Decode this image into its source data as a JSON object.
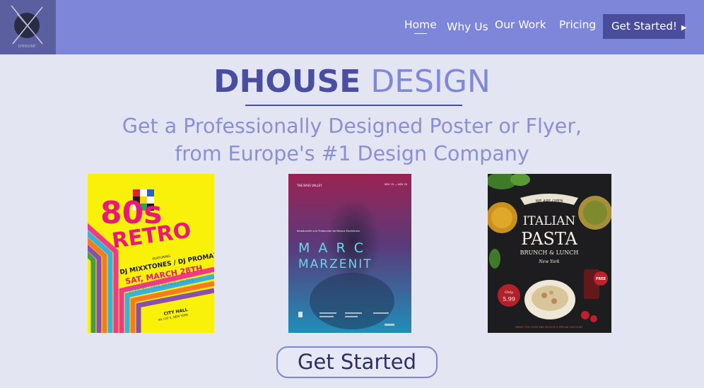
{
  "nav": {
    "logo_text": "DHOUSE",
    "links": [
      "Home",
      "Why Us",
      "Our Work",
      "Pricing"
    ],
    "cta_label": "Get Started!",
    "cta_arrow": "▶"
  },
  "hero": {
    "brand_bold": "DHOUSE",
    "brand_light": "DESIGN",
    "tagline_line1": "Get a Professionally Designed Poster or Flyer,",
    "tagline_line2": "from Europe's #1 Design Company"
  },
  "posters": {
    "retro": {
      "line1": "80s",
      "line2": "RETRO",
      "featuring": "FEATURING",
      "djs": "DJ MIXXTONES / DJ PROMAX",
      "date": "SAT, MARCH 28TH",
      "entry": "$5 ENTRY / FREE DRINKS / PRIZES",
      "venue": "CITY HALL",
      "address": "WL CAT 5, NEW YORK"
    },
    "marc": {
      "top_left": "THE BASS VALLEY",
      "top_right": "NOV 15 — NOV 19",
      "intro": "Introducción a la Producción de Música Electrónica",
      "name1": "M A R C",
      "name2": "MARZENIT"
    },
    "pasta": {
      "ribbon": "WE ARE OPEN",
      "title1": "ITALIAN",
      "title2": "PASTA",
      "subtitle": "BRUNCH & LUNCH",
      "city": "New York",
      "price_only": "Only",
      "price": "5.99",
      "badge": "FREE",
      "footer": "BRING THIS FLYER AND RECEIVE A SPECIAL DISCOUNT"
    }
  },
  "cta": {
    "label": "Get Started"
  },
  "colors": {
    "nav_bg": "#7d86d8",
    "logo_bg": "#5c5f9f",
    "page_bg": "#e3e5f2",
    "brand_dark": "#4a4e9f",
    "brand_light": "#8188d8",
    "nav_cta_bg": "#4a4c9c"
  }
}
